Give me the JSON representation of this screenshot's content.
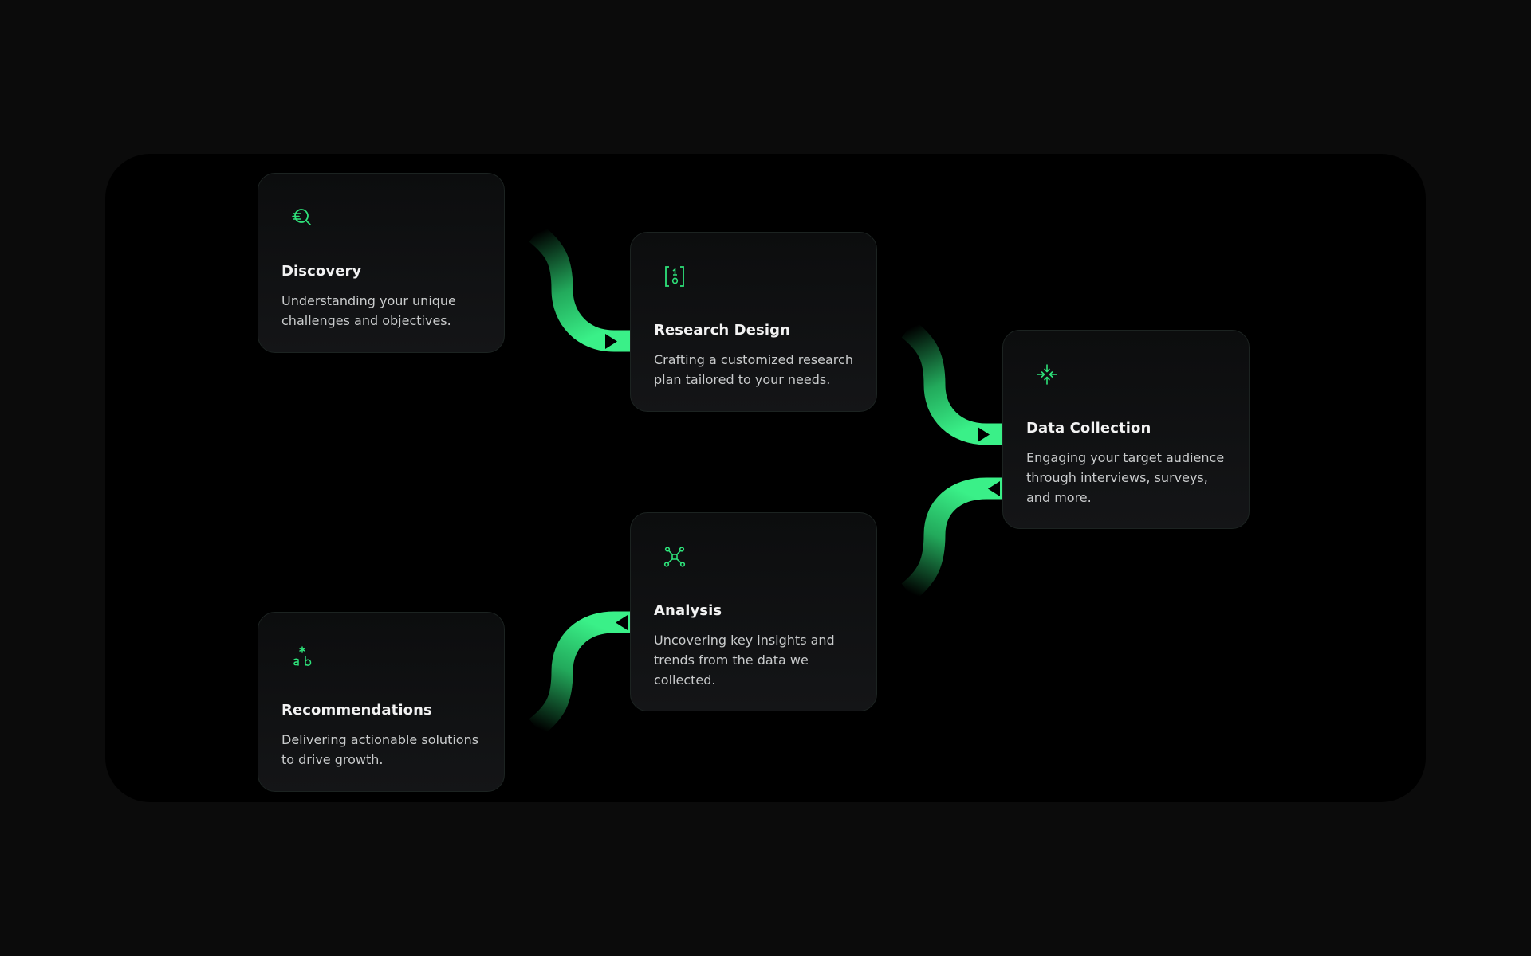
{
  "process": {
    "accent_color": "#2ee27a",
    "steps": [
      {
        "id": "discovery",
        "icon": "search-lines-icon",
        "title": "Discovery",
        "description": "Understanding your unique challenges and objectives."
      },
      {
        "id": "research-design",
        "icon": "bracket-binary-icon",
        "title": "Research Design",
        "description": "Crafting a customized research plan tailored to your needs."
      },
      {
        "id": "data-collection",
        "icon": "converge-arrows-icon",
        "title": "Data Collection",
        "description": "Engaging your target audience through interviews, surveys, and more."
      },
      {
        "id": "analysis",
        "icon": "network-nodes-icon",
        "title": "Analysis",
        "description": "Uncovering key insights and trends from the data we collected."
      },
      {
        "id": "recommendations",
        "icon": "asterisk-ab-icon",
        "title": "Recommendations",
        "description": "Delivering actionable solutions to drive growth."
      }
    ]
  }
}
